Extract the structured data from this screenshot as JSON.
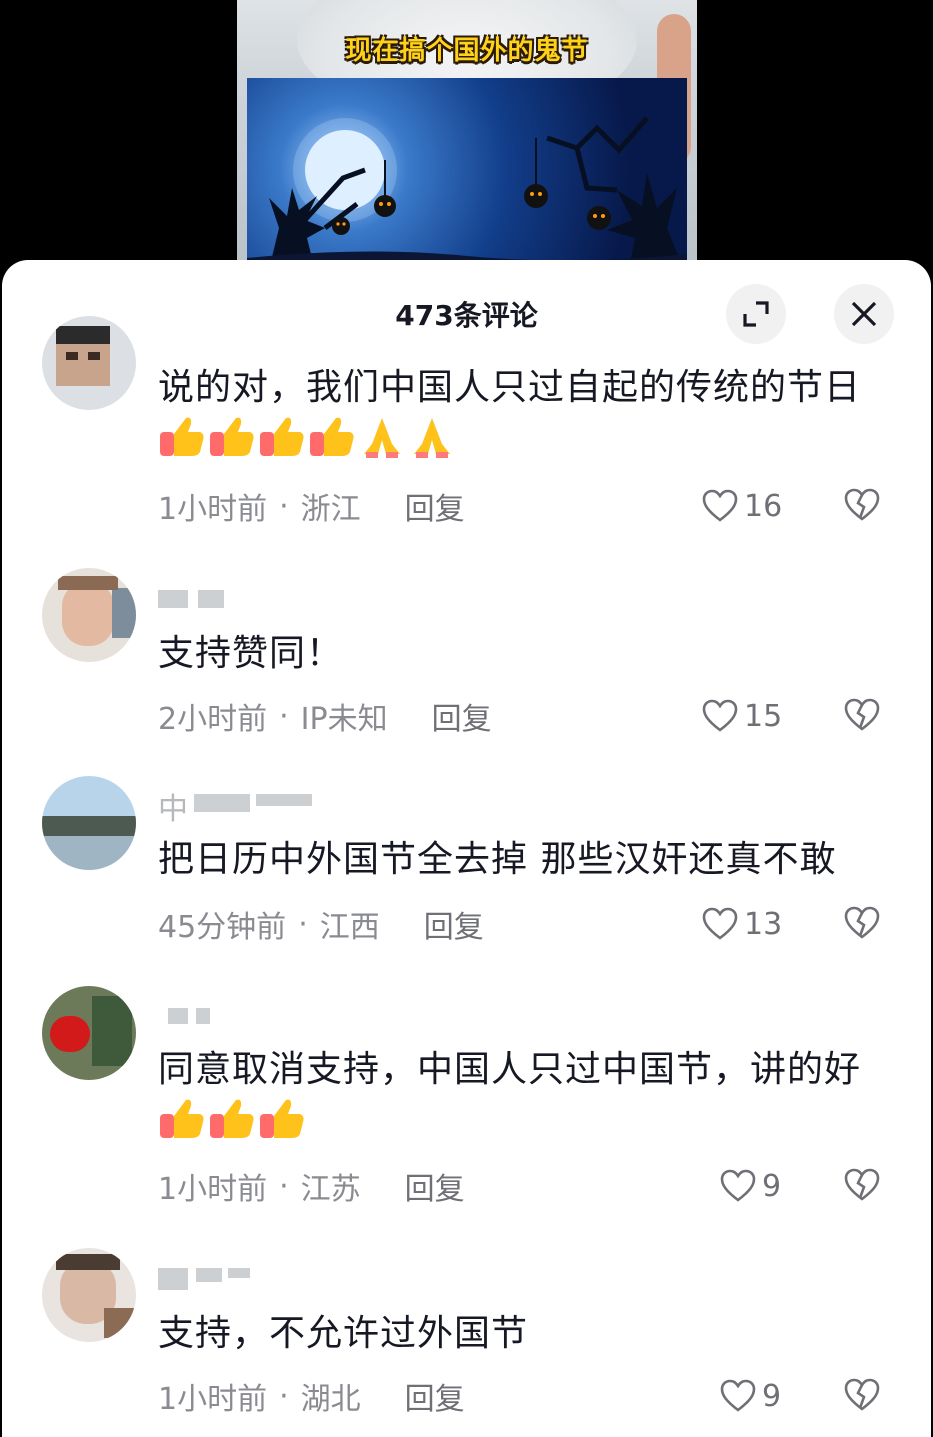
{
  "video": {
    "caption": "现在搞个国外的鬼节"
  },
  "header": {
    "title": "473条评论",
    "expand_icon": "expand-icon",
    "close_icon": "close-icon"
  },
  "comments": [
    {
      "username": "",
      "text": "说的对，我们中国人只过自起的传统的节日",
      "emojis": [
        "thumbs-up",
        "thumbs-up",
        "thumbs-up",
        "thumbs-up",
        "folded-hands",
        "folded-hands"
      ],
      "time": "1小时前",
      "sep": "·",
      "location": "浙江",
      "reply": "回复",
      "likes": "16"
    },
    {
      "username": "",
      "text": "支持赞同！",
      "emojis": [],
      "time": "2小时前",
      "sep": "·",
      "location": "IP未知",
      "reply": "回复",
      "likes": "15"
    },
    {
      "username": "中",
      "text": "把日历中外国节全去掉  那些汉奸还真不敢",
      "emojis": [],
      "time": "45分钟前",
      "sep": "·",
      "location": "江西",
      "reply": "回复",
      "likes": "13"
    },
    {
      "username": "",
      "text": "同意取消支持，中国人只过中国节，讲的好",
      "emojis": [
        "thumbs-up",
        "thumbs-up",
        "thumbs-up"
      ],
      "time": "1小时前",
      "sep": "·",
      "location": "江苏",
      "reply": "回复",
      "likes": "9"
    },
    {
      "username": "",
      "text": "支持，不允许过外国节",
      "emojis": [],
      "time": "1小时前",
      "sep": "·",
      "location": "湖北",
      "reply": "回复",
      "likes": "9"
    }
  ]
}
